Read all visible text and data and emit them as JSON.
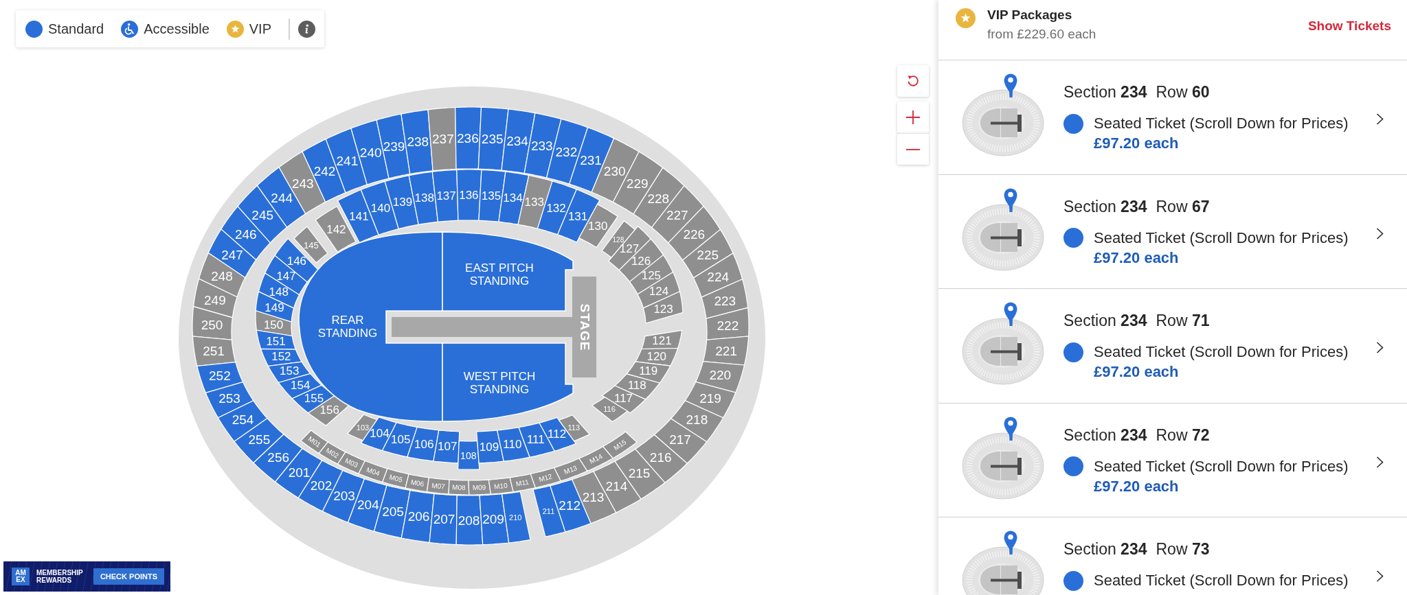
{
  "legend": {
    "items": [
      {
        "label": "Standard",
        "kind": "standard",
        "color": "#2a6fd7"
      },
      {
        "label": "Accessible",
        "kind": "accessible",
        "color": "#2a6fd7"
      },
      {
        "label": "VIP",
        "kind": "vip",
        "color": "#e8b53e"
      }
    ]
  },
  "map": {
    "upper_tier": {
      "top": [
        {
          "label": "243",
          "available": false
        },
        {
          "label": "242",
          "available": true
        },
        {
          "label": "241",
          "available": true
        },
        {
          "label": "240",
          "available": true
        },
        {
          "label": "239",
          "available": true
        },
        {
          "label": "238",
          "available": true
        },
        {
          "label": "237",
          "available": false
        },
        {
          "label": "236",
          "available": true
        },
        {
          "label": "235",
          "available": true
        },
        {
          "label": "234",
          "available": true
        },
        {
          "label": "233",
          "available": true
        },
        {
          "label": "232",
          "available": true
        },
        {
          "label": "231",
          "available": true
        }
      ],
      "left": [
        {
          "label": "244",
          "available": true
        },
        {
          "label": "245",
          "available": true
        },
        {
          "label": "246",
          "available": true
        },
        {
          "label": "247",
          "available": true
        },
        {
          "label": "248",
          "available": false
        },
        {
          "label": "249",
          "available": false
        },
        {
          "label": "250",
          "available": false
        },
        {
          "label": "251",
          "available": false
        },
        {
          "label": "252",
          "available": true
        },
        {
          "label": "253",
          "available": true
        },
        {
          "label": "254",
          "available": true
        },
        {
          "label": "255",
          "available": true
        },
        {
          "label": "256",
          "available": true
        }
      ],
      "right": [
        {
          "label": "230",
          "available": false
        },
        {
          "label": "229",
          "available": false
        },
        {
          "label": "228",
          "available": false
        },
        {
          "label": "227",
          "available": false
        },
        {
          "label": "226",
          "available": false
        },
        {
          "label": "225",
          "available": false
        },
        {
          "label": "224",
          "available": false
        },
        {
          "label": "223",
          "available": false
        },
        {
          "label": "222",
          "available": false
        },
        {
          "label": "221",
          "available": false
        },
        {
          "label": "220",
          "available": false
        },
        {
          "label": "219",
          "available": false
        },
        {
          "label": "218",
          "available": false
        },
        {
          "label": "217",
          "available": false
        },
        {
          "label": "216",
          "available": false
        },
        {
          "label": "215",
          "available": false
        },
        {
          "label": "214",
          "available": false
        },
        {
          "label": "213",
          "available": false
        }
      ],
      "bottom": [
        {
          "label": "201",
          "available": true
        },
        {
          "label": "202",
          "available": true
        },
        {
          "label": "203",
          "available": true
        },
        {
          "label": "204",
          "available": true
        },
        {
          "label": "205",
          "available": true
        },
        {
          "label": "206",
          "available": true
        },
        {
          "label": "207",
          "available": true
        },
        {
          "label": "208",
          "available": true
        },
        {
          "label": "209",
          "available": true
        },
        {
          "label": "210",
          "available": true
        },
        {
          "label": "211",
          "available": true
        },
        {
          "label": "212",
          "available": true
        }
      ]
    },
    "lower_tier": {
      "top": [
        {
          "label": "142",
          "available": false
        },
        {
          "label": "141",
          "available": true
        },
        {
          "label": "140",
          "available": true
        },
        {
          "label": "139",
          "available": true
        },
        {
          "label": "138",
          "available": true
        },
        {
          "label": "137",
          "available": true
        },
        {
          "label": "136",
          "available": true
        },
        {
          "label": "135",
          "available": true
        },
        {
          "label": "134",
          "available": true
        },
        {
          "label": "133",
          "available": false
        },
        {
          "label": "132",
          "available": true
        },
        {
          "label": "131",
          "available": true
        },
        {
          "label": "130",
          "available": false
        }
      ],
      "left": [
        {
          "label": "145",
          "available": false
        },
        {
          "label": "146",
          "available": true
        },
        {
          "label": "147",
          "available": true
        },
        {
          "label": "148",
          "available": true
        },
        {
          "label": "149",
          "available": true
        },
        {
          "label": "150",
          "available": false
        },
        {
          "label": "151",
          "available": true
        },
        {
          "label": "152",
          "available": true
        },
        {
          "label": "153",
          "available": true
        },
        {
          "label": "154",
          "available": true
        },
        {
          "label": "155",
          "available": true
        },
        {
          "label": "156",
          "available": false
        }
      ],
      "right": [
        {
          "label": "128",
          "available": false
        },
        {
          "label": "127",
          "available": false
        },
        {
          "label": "126",
          "available": false
        },
        {
          "label": "125",
          "available": false
        },
        {
          "label": "124",
          "available": false
        },
        {
          "label": "123",
          "available": false
        },
        {
          "label": "121",
          "available": false
        },
        {
          "label": "120",
          "available": false
        },
        {
          "label": "119",
          "available": false
        },
        {
          "label": "118",
          "available": false
        },
        {
          "label": "117",
          "available": false
        },
        {
          "label": "116",
          "available": false
        }
      ],
      "bottom": [
        {
          "label": "103",
          "available": false
        },
        {
          "label": "104",
          "available": true
        },
        {
          "label": "105",
          "available": true
        },
        {
          "label": "106",
          "available": true
        },
        {
          "label": "107",
          "available": true
        },
        {
          "label": "108",
          "available": true
        },
        {
          "label": "109",
          "available": true
        },
        {
          "label": "110",
          "available": true
        },
        {
          "label": "111",
          "available": true
        },
        {
          "label": "112",
          "available": true
        },
        {
          "label": "113",
          "available": false
        }
      ]
    },
    "middle_tier": [
      {
        "label": "M01",
        "available": false
      },
      {
        "label": "M02",
        "available": false
      },
      {
        "label": "M03",
        "available": false
      },
      {
        "label": "M04",
        "available": false
      },
      {
        "label": "M05",
        "available": false
      },
      {
        "label": "M06",
        "available": false
      },
      {
        "label": "M07",
        "available": false
      },
      {
        "label": "M08",
        "available": false
      },
      {
        "label": "M09",
        "available": false
      },
      {
        "label": "M10",
        "available": false
      },
      {
        "label": "M11",
        "available": false
      },
      {
        "label": "M12",
        "available": false
      },
      {
        "label": "M13",
        "available": false
      },
      {
        "label": "M14",
        "available": false
      },
      {
        "label": "M15",
        "available": false
      }
    ],
    "standing_areas": [
      {
        "label": "REAR STANDING",
        "available": true
      },
      {
        "label": "EAST PITCH STANDING",
        "available": true
      },
      {
        "label": "WEST PITCH STANDING",
        "available": true
      }
    ],
    "stage": "STAGE"
  },
  "rewards_banner": {
    "logo": "AMEX",
    "title": "MEMBERSHIP REWARDS",
    "button": "CHECK POINTS"
  },
  "vip_packages": {
    "title": "VIP Packages",
    "price": "from £229.60 each",
    "action": "Show Tickets"
  },
  "listings": [
    {
      "section": "Section **234**",
      "row": "Row **60**",
      "ticket_type": "Seated Ticket (Scroll Down for Prices)",
      "price": "£97.20 each"
    },
    {
      "section": "Section **234**",
      "row": "Row **67**",
      "ticket_type": "Seated Ticket (Scroll Down for Prices)",
      "price": "£97.20 each"
    },
    {
      "section": "Section **234**",
      "row": "Row **71**",
      "ticket_type": "Seated Ticket (Scroll Down for Prices)",
      "price": "£97.20 each"
    },
    {
      "section": "Section **234**",
      "row": "Row **72**",
      "ticket_type": "Seated Ticket (Scroll Down for Prices)",
      "price": "£97.20 each"
    },
    {
      "section": "Section **234**",
      "row": "Row **73**",
      "ticket_type": "Seated Ticket (Scroll Down for Prices)"
    }
  ]
}
